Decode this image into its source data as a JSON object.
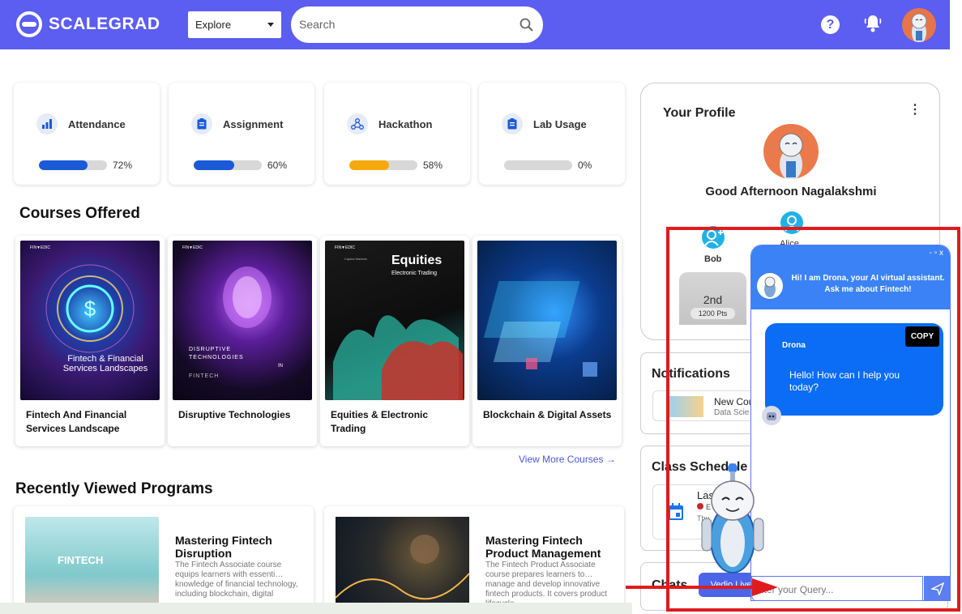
{
  "brand": {
    "name": "SCALEGRAD"
  },
  "header": {
    "explore_label": "Explore",
    "search_placeholder": "Search",
    "help_label": "?"
  },
  "stats": [
    {
      "title": "Attendance",
      "pct_label": "72%",
      "value": 72,
      "color": "#1a5ad6",
      "icon": "bar-chart-icon"
    },
    {
      "title": "Assignment",
      "pct_label": "60%",
      "value": 60,
      "color": "#1a5ad6",
      "icon": "clipboard-icon"
    },
    {
      "title": "Hackathon",
      "pct_label": "58%",
      "value": 58,
      "color": "#f6a90c",
      "icon": "network-icon"
    },
    {
      "title": "Lab Usage",
      "pct_label": "0%",
      "value": 0,
      "color": "#1a5ad6",
      "icon": "clipboard-icon"
    }
  ],
  "courses": {
    "heading": "Courses Offered",
    "items": [
      {
        "title": "Fintech And Financial Services Landscape",
        "img_caption": "Fintech & Financial Services Landscapes",
        "brand": "FIN▼EDIC"
      },
      {
        "title": "Disruptive Technologies",
        "img_caption": "DISRUPTIVE TECHNOLOGIES",
        "img_in": "IN",
        "img_sub": "FINTECH",
        "brand": "FIN▼EDIC"
      },
      {
        "title": "Equities & Electronic Trading",
        "img_caption": "Equities",
        "img_sub": "Electronic Trading",
        "img_tag": "Capital Markets",
        "brand": "FIN▼EDIC"
      },
      {
        "title": "Blockchain & Digital Assets"
      }
    ],
    "view_more": "View More Courses →"
  },
  "recent": {
    "heading": "Recently Viewed Programs",
    "items": [
      {
        "title": "Mastering Fintech Disruption",
        "desc": "The Fintech Associate course equips learners with essenti… knowledge of financial technology, including blockchain, digital",
        "img_text": "FINTECH"
      },
      {
        "title": "Mastering Fintech Product Management",
        "desc": "The Fintech Product Associate course prepares learners to… manage and develop innovative fintech products. It covers product lifecycle"
      }
    ]
  },
  "profile": {
    "title": "Your Profile",
    "greeting": "Good Afternoon Nagalakshmi",
    "leaders": [
      {
        "name": "Bob"
      },
      {
        "name": "Alice"
      }
    ],
    "rank": "2nd",
    "points": "1200 Pts"
  },
  "notifications": {
    "title": "Notifications",
    "item_title": "New Cou",
    "item_sub": "Data Scie"
  },
  "schedule": {
    "title": "Class Schedule",
    "item_title": "Last",
    "item_status": "E",
    "item_time": "Thu"
  },
  "chats": {
    "title": "Chats",
    "button": "Vedio Live"
  },
  "chatbot": {
    "window_controls": "-  ▫  x",
    "intro": "Hi! I am Drona, your AI virtual assistant. Ask me about Fintech!",
    "sender": "Drona",
    "message": "Hello! How can I help you today?",
    "copy_label": "COPY",
    "input_placeholder": "nter your Query..."
  }
}
